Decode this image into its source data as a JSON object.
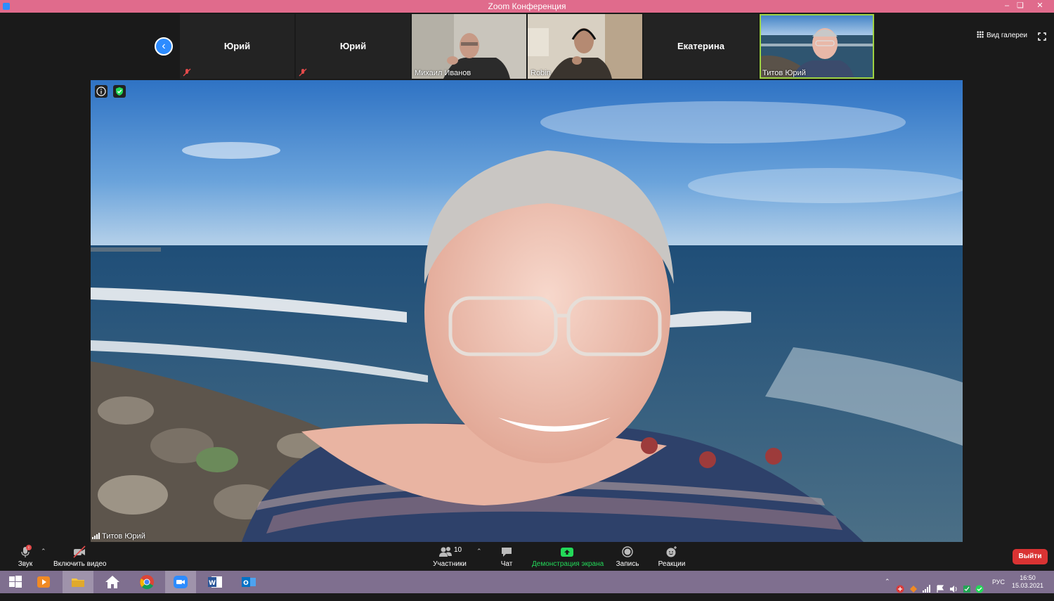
{
  "window": {
    "title": "Zoom Конференция"
  },
  "participants_strip": [
    {
      "name": "Юрий",
      "video": false,
      "muted": true
    },
    {
      "name": "Юрий",
      "video": false,
      "muted": true
    },
    {
      "name": "Михаил Иванов",
      "video": true,
      "muted": false
    },
    {
      "name": "Robin",
      "video": true,
      "muted": false
    },
    {
      "name": "Екатерина",
      "video": false,
      "muted": false
    },
    {
      "name": "Титов Юрий",
      "video": true,
      "muted": false,
      "active": true
    }
  ],
  "view": {
    "gallery_label": "Вид галереи"
  },
  "main_video": {
    "speaker_name": "Титов Юрий"
  },
  "toolbar": {
    "audio_label": "Звук",
    "video_label": "Включить видео",
    "participants_label": "Участники",
    "participants_count": "10",
    "chat_label": "Чат",
    "share_label": "Демонстрация экрана",
    "record_label": "Запись",
    "reactions_label": "Реакции",
    "leave_label": "Выйти"
  },
  "colors": {
    "accent_blue": "#2d8cff",
    "share_green": "#23d959",
    "leave_red": "#d93333",
    "active_speaker": "#9ed342",
    "titlebar": "#e06b8c"
  },
  "taskbar": {
    "apps": [
      "start-icon",
      "media-player-icon",
      "file-explorer-icon",
      "home-icon",
      "chrome-icon",
      "zoom-icon",
      "word-icon",
      "outlook-icon"
    ],
    "language": "РУС",
    "time": "16:50",
    "date": "15.03.2021"
  }
}
